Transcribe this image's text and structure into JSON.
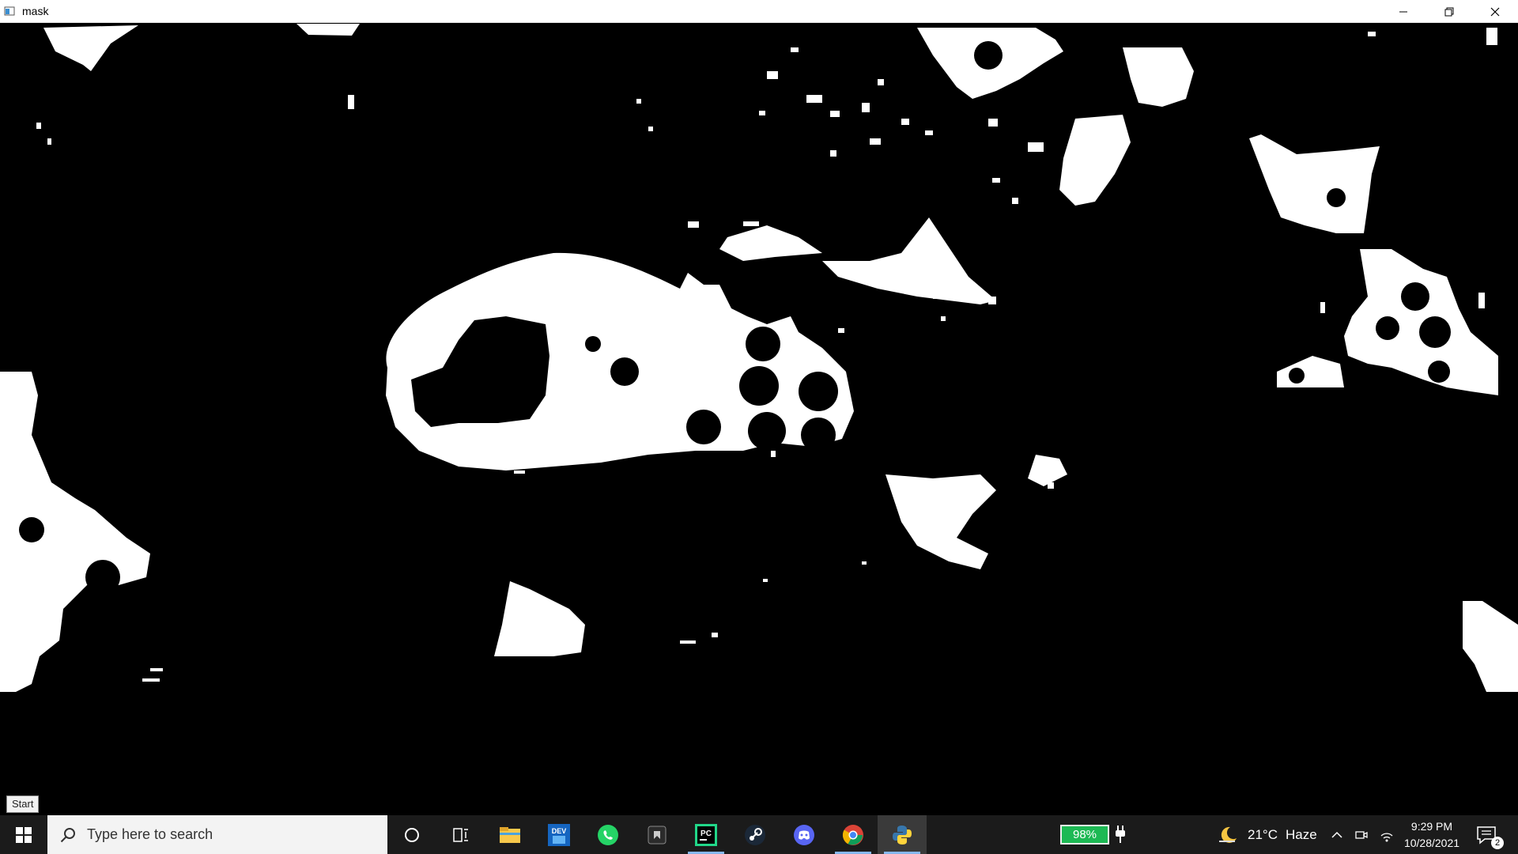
{
  "window": {
    "title": "mask",
    "controls": [
      "minimize",
      "restore",
      "close"
    ]
  },
  "tooltip": {
    "text": "Start"
  },
  "taskbar": {
    "search_placeholder": "Type here to search",
    "pinned_apps": [
      {
        "name": "task-view-icon"
      },
      {
        "name": "cortana-icon"
      },
      {
        "name": "file-explorer-icon"
      },
      {
        "name": "dev-c-icon"
      },
      {
        "name": "whatsapp-icon"
      },
      {
        "name": "app-icon"
      },
      {
        "name": "pycharm-icon"
      },
      {
        "name": "steam-icon"
      },
      {
        "name": "discord-icon"
      },
      {
        "name": "chrome-icon"
      },
      {
        "name": "python-icon"
      }
    ],
    "battery": "98%",
    "weather": {
      "temp": "21°C",
      "condition": "Haze"
    },
    "clock": {
      "time": "9:29 PM",
      "date": "10/28/2021"
    },
    "notifications_count": "2",
    "colors": {
      "taskbar_bg": "#1b1b1b",
      "battery_green": "#1db954",
      "active_indicator": "#86b7ec"
    }
  }
}
